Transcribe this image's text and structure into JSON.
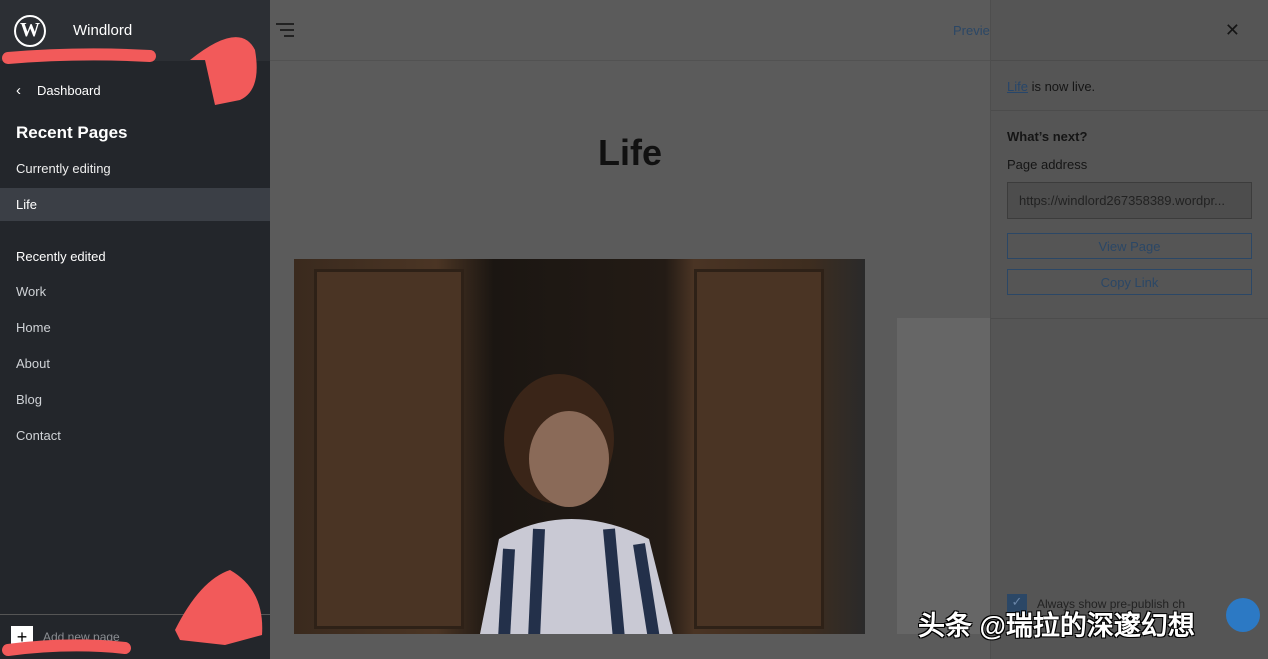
{
  "sidebar": {
    "site_name": "Windlord",
    "back_label": "Dashboard",
    "heading": "Recent Pages",
    "currently_editing": "Currently editing",
    "active_page": "Life",
    "recently_edited": "Recently edited",
    "items": [
      {
        "label": "Work"
      },
      {
        "label": "Home"
      },
      {
        "label": "About"
      },
      {
        "label": "Blog"
      },
      {
        "label": "Contact"
      }
    ],
    "add_new": "Add new page"
  },
  "editor": {
    "preview_label": "Previe",
    "page_title": "Life"
  },
  "panel": {
    "live_link": "Life",
    "live_text": " is now live.",
    "whats_next": "What’s next?",
    "page_address_label": "Page address",
    "page_address": "https://windlord267358389.wordpr...",
    "view_page": "View Page",
    "copy_link": "Copy Link",
    "checkbox_label": "Always show pre-publish ch",
    "checkbox_checked": true
  },
  "watermark": "头条 @瑞拉的深邃幻想",
  "colors": {
    "sidebar": "#23262b",
    "accent": "#2b4766",
    "annotation": "#f25a5a"
  }
}
